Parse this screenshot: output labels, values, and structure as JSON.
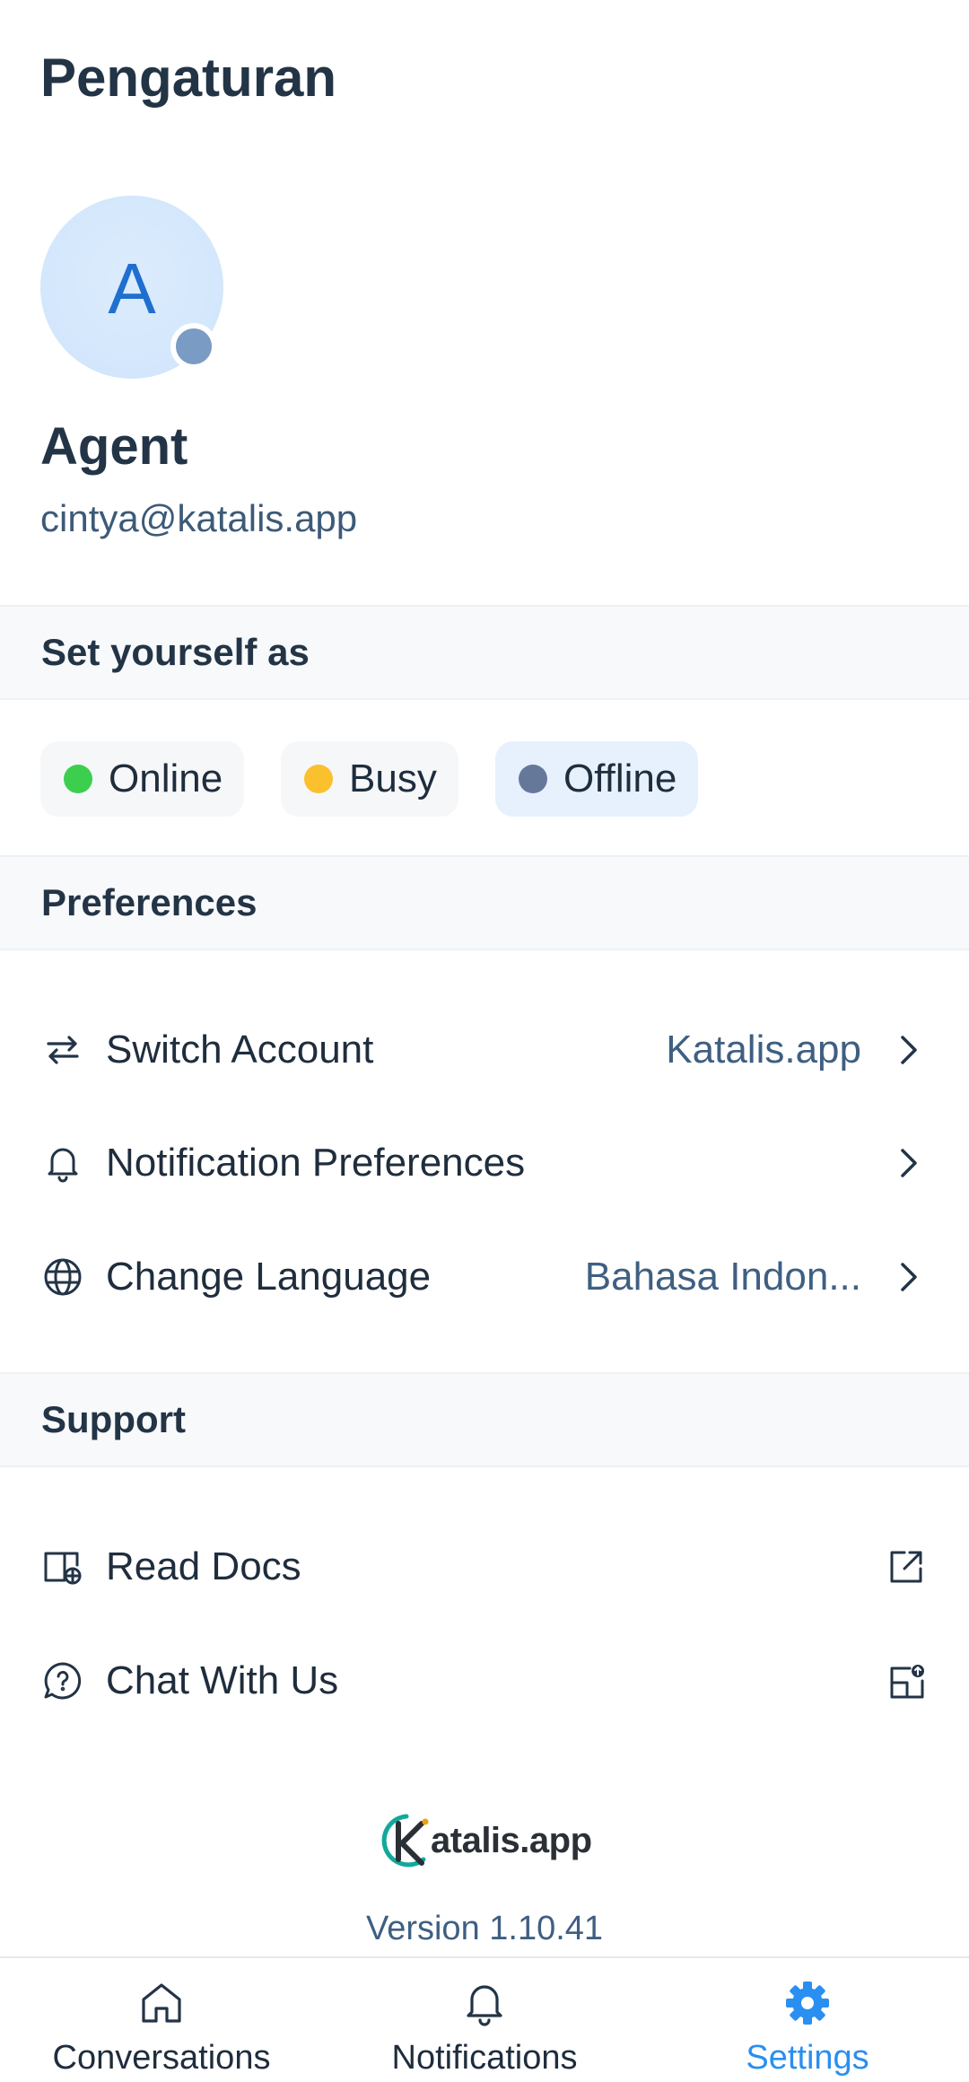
{
  "page": {
    "title": "Pengaturan"
  },
  "profile": {
    "initial": "A",
    "name": "Agent",
    "email": "cintya@katalis.app",
    "status_color": "#7a9bc3"
  },
  "availability": {
    "header": "Set yourself as",
    "options": [
      {
        "label": "Online",
        "color": "#3ccf4e",
        "selected": false
      },
      {
        "label": "Busy",
        "color": "#fbc02d",
        "selected": false
      },
      {
        "label": "Offline",
        "color": "#66789a",
        "selected": true
      }
    ]
  },
  "preferences": {
    "header": "Preferences",
    "items": [
      {
        "label": "Switch Account",
        "value": "Katalis.app",
        "icon": "switch-icon"
      },
      {
        "label": "Notification Preferences",
        "value": "",
        "icon": "bell-icon"
      },
      {
        "label": "Change Language",
        "value": "Bahasa Indon...",
        "icon": "globe-icon"
      }
    ]
  },
  "support": {
    "header": "Support",
    "items": [
      {
        "label": "Read Docs",
        "icon": "docs-icon",
        "action_icon": "external-link-icon"
      },
      {
        "label": "Chat With Us",
        "icon": "help-chat-icon",
        "action_icon": "share-icon"
      }
    ]
  },
  "footer": {
    "brand": "atalis.app",
    "version": "Version 1.10.41"
  },
  "tabbar": {
    "tabs": [
      {
        "label": "Conversations",
        "icon": "home-icon",
        "active": false
      },
      {
        "label": "Notifications",
        "icon": "bell-icon",
        "active": false
      },
      {
        "label": "Settings",
        "icon": "gear-icon",
        "active": true
      }
    ]
  },
  "colors": {
    "accent": "#2a8ff0",
    "text_primary": "#233446",
    "text_secondary": "#3f5f82",
    "section_bg": "#f7f9fb"
  }
}
